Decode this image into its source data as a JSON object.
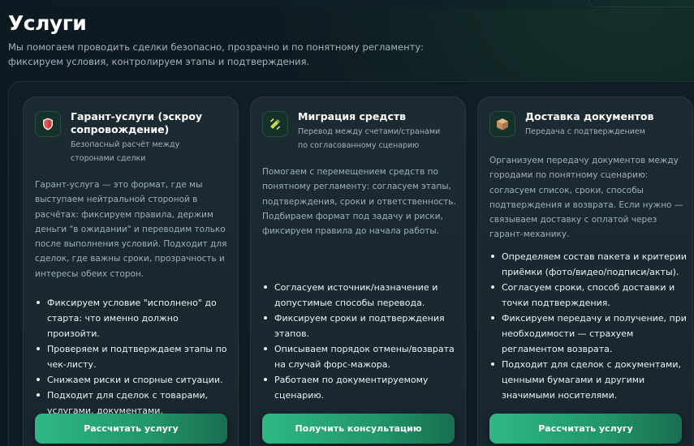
{
  "header": {
    "title": "Услуги",
    "subtitle": "Мы помогаем проводить сделки безопасно, прозрачно и по понятному регламенту: фиксируем условия, контролируем этапы и подтверждения."
  },
  "cards": [
    {
      "icon": "shield-icon",
      "title": "Гарант-услуги (эскроу сопровождение)",
      "subtitle": "Безопасный расчёт между сторонами сделки",
      "description": "Гарант-услуга — это формат, где мы выступаем нейтральной стороной в расчётах: фиксируем правила, держим деньги \"в ожидании\" и переводим только после выполнения условий. Подходит для сделок, где важны сроки, прозрачность и интересы обеих сторон.",
      "bullets": [
        "Фиксируем условие \"исполнено\" до старта: что именно должно произойти.",
        "Проверяем и подтверждаем этапы по чек-листу.",
        "Снижаем риски и спорные ситуации.",
        "Подходит для сделок с товарами, услугами, документами."
      ],
      "button_label": "Рассчитать услугу"
    },
    {
      "icon": "migration-icon",
      "title": "Миграция средств",
      "subtitle": "Перевод между счетами/странами по согласованному сценарию",
      "description": "Помогаем с перемещением средств по понятному регламенту: согласуем этапы, подтверждения, сроки и ответственность. Подбираем формат под задачу и риски, фиксируем правила до начала работы.",
      "bullets": [
        "Согласуем источник/назначение и допустимые способы перевода.",
        "Фиксируем сроки и подтверждения этапов.",
        "Описываем порядок отмены/возврата на случай форс-мажора.",
        "Работаем по документируемому сценарию."
      ],
      "button_label": "Получить консультацию"
    },
    {
      "icon": "package-icon",
      "title": "Доставка документов",
      "subtitle": "Передача с подтверждением",
      "description": "Организуем передачу документов между городами по понятному сценарию: согласуем список, сроки, способы подтверждения и возврата. Если нужно — связываем доставку с оплатой через гарант-механику.",
      "bullets": [
        "Определяем состав пакета и критерии приёмки (фото/видео/подписи/акты).",
        "Согласуем сроки, способ доставки и точки подтверждения.",
        "Фиксируем передачу и получение, при необходимости — страхуем регламентом возврата.",
        "Подходит для сделок с документами, ценными бумагами и другими значимыми носителями."
      ],
      "button_label": "Рассчитать услугу"
    }
  ]
}
